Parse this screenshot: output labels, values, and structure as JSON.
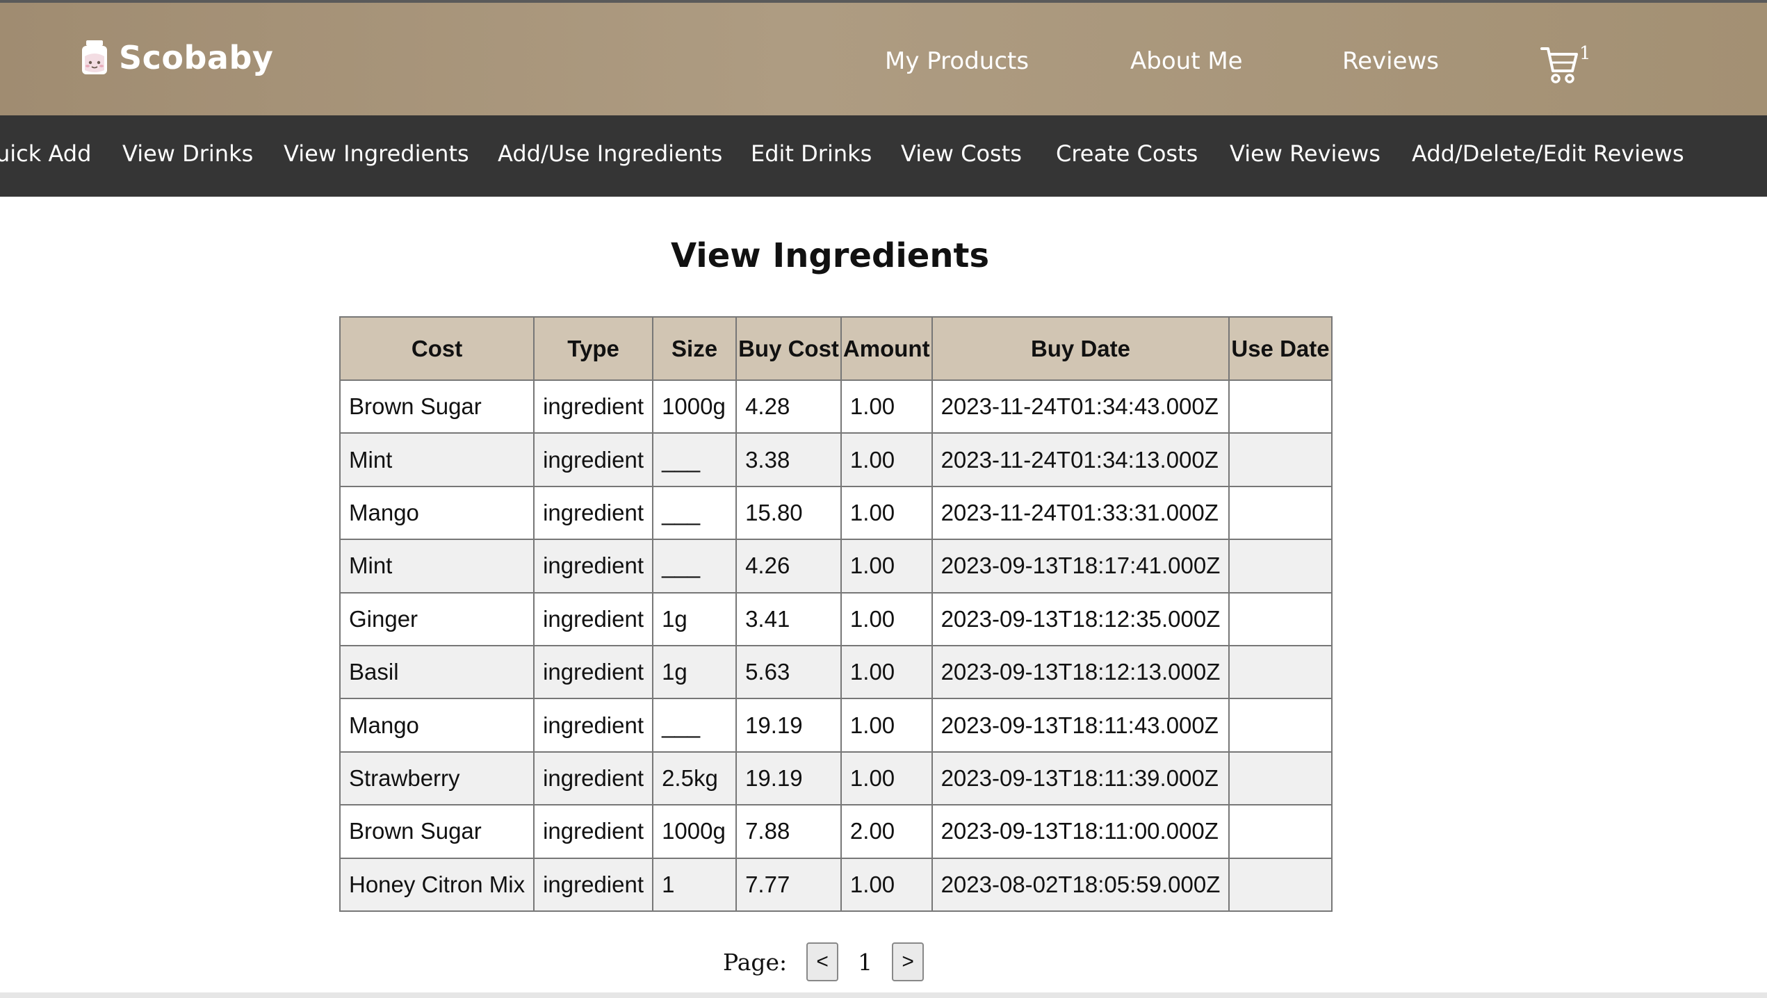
{
  "header": {
    "brand": "Scobaby",
    "nav": [
      "My Products",
      "About Me",
      "Reviews"
    ],
    "cart_count": "1",
    "brand_color": "#a89579",
    "subnav_bg": "#353535"
  },
  "subnav": [
    "uick Add",
    "View Drinks",
    "View Ingredients",
    "Add/Use Ingredients",
    "Edit Drinks",
    "View Costs",
    "Create Costs",
    "View Reviews",
    "Add/Delete/Edit Reviews"
  ],
  "main": {
    "title": "View Ingredients",
    "table": {
      "header_color": "#d1c5b3",
      "columns": [
        "Cost",
        "Type",
        "Size",
        "Buy Cost",
        "Amount",
        "Buy Date",
        "Use Date"
      ],
      "rows": [
        [
          "Brown Sugar",
          "ingredient",
          "1000g",
          "4.28",
          "1.00",
          "2023-11-24T01:34:43.000Z",
          ""
        ],
        [
          "Mint",
          "ingredient",
          "___",
          "3.38",
          "1.00",
          "2023-11-24T01:34:13.000Z",
          ""
        ],
        [
          "Mango",
          "ingredient",
          "___",
          "15.80",
          "1.00",
          "2023-11-24T01:33:31.000Z",
          ""
        ],
        [
          "Mint",
          "ingredient",
          "___",
          "4.26",
          "1.00",
          "2023-09-13T18:17:41.000Z",
          ""
        ],
        [
          "Ginger",
          "ingredient",
          "1g",
          "3.41",
          "1.00",
          "2023-09-13T18:12:35.000Z",
          ""
        ],
        [
          "Basil",
          "ingredient",
          "1g",
          "5.63",
          "1.00",
          "2023-09-13T18:12:13.000Z",
          ""
        ],
        [
          "Mango",
          "ingredient",
          "___",
          "19.19",
          "1.00",
          "2023-09-13T18:11:43.000Z",
          ""
        ],
        [
          "Strawberry",
          "ingredient",
          "2.5kg",
          "19.19",
          "1.00",
          "2023-09-13T18:11:39.000Z",
          ""
        ],
        [
          "Brown Sugar",
          "ingredient",
          "1000g",
          "7.88",
          "2.00",
          "2023-09-13T18:11:00.000Z",
          ""
        ],
        [
          "Honey Citron Mix",
          "ingredient",
          "1",
          "7.77",
          "1.00",
          "2023-08-02T18:05:59.000Z",
          ""
        ]
      ]
    },
    "pager": {
      "label": "Page:",
      "prev": "<",
      "current": "1",
      "next": ">"
    }
  }
}
